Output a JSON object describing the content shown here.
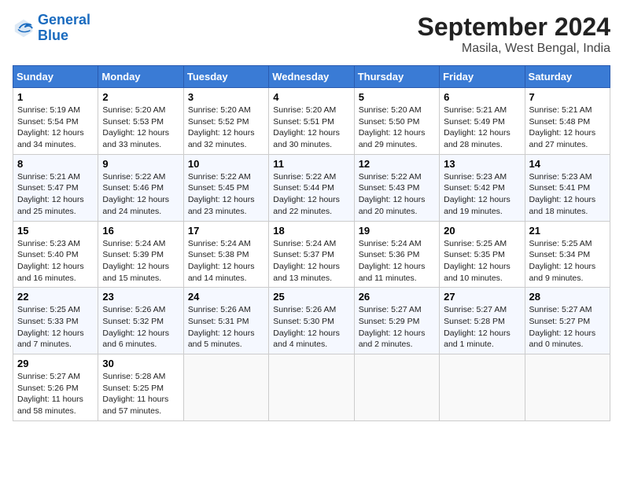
{
  "logo": {
    "line1": "General",
    "line2": "Blue"
  },
  "title": "September 2024",
  "subtitle": "Masila, West Bengal, India",
  "header_days": [
    "Sunday",
    "Monday",
    "Tuesday",
    "Wednesday",
    "Thursday",
    "Friday",
    "Saturday"
  ],
  "weeks": [
    [
      {
        "day": "1",
        "info": "Sunrise: 5:19 AM\nSunset: 5:54 PM\nDaylight: 12 hours\nand 34 minutes."
      },
      {
        "day": "2",
        "info": "Sunrise: 5:20 AM\nSunset: 5:53 PM\nDaylight: 12 hours\nand 33 minutes."
      },
      {
        "day": "3",
        "info": "Sunrise: 5:20 AM\nSunset: 5:52 PM\nDaylight: 12 hours\nand 32 minutes."
      },
      {
        "day": "4",
        "info": "Sunrise: 5:20 AM\nSunset: 5:51 PM\nDaylight: 12 hours\nand 30 minutes."
      },
      {
        "day": "5",
        "info": "Sunrise: 5:20 AM\nSunset: 5:50 PM\nDaylight: 12 hours\nand 29 minutes."
      },
      {
        "day": "6",
        "info": "Sunrise: 5:21 AM\nSunset: 5:49 PM\nDaylight: 12 hours\nand 28 minutes."
      },
      {
        "day": "7",
        "info": "Sunrise: 5:21 AM\nSunset: 5:48 PM\nDaylight: 12 hours\nand 27 minutes."
      }
    ],
    [
      {
        "day": "8",
        "info": "Sunrise: 5:21 AM\nSunset: 5:47 PM\nDaylight: 12 hours\nand 25 minutes."
      },
      {
        "day": "9",
        "info": "Sunrise: 5:22 AM\nSunset: 5:46 PM\nDaylight: 12 hours\nand 24 minutes."
      },
      {
        "day": "10",
        "info": "Sunrise: 5:22 AM\nSunset: 5:45 PM\nDaylight: 12 hours\nand 23 minutes."
      },
      {
        "day": "11",
        "info": "Sunrise: 5:22 AM\nSunset: 5:44 PM\nDaylight: 12 hours\nand 22 minutes."
      },
      {
        "day": "12",
        "info": "Sunrise: 5:22 AM\nSunset: 5:43 PM\nDaylight: 12 hours\nand 20 minutes."
      },
      {
        "day": "13",
        "info": "Sunrise: 5:23 AM\nSunset: 5:42 PM\nDaylight: 12 hours\nand 19 minutes."
      },
      {
        "day": "14",
        "info": "Sunrise: 5:23 AM\nSunset: 5:41 PM\nDaylight: 12 hours\nand 18 minutes."
      }
    ],
    [
      {
        "day": "15",
        "info": "Sunrise: 5:23 AM\nSunset: 5:40 PM\nDaylight: 12 hours\nand 16 minutes."
      },
      {
        "day": "16",
        "info": "Sunrise: 5:24 AM\nSunset: 5:39 PM\nDaylight: 12 hours\nand 15 minutes."
      },
      {
        "day": "17",
        "info": "Sunrise: 5:24 AM\nSunset: 5:38 PM\nDaylight: 12 hours\nand 14 minutes."
      },
      {
        "day": "18",
        "info": "Sunrise: 5:24 AM\nSunset: 5:37 PM\nDaylight: 12 hours\nand 13 minutes."
      },
      {
        "day": "19",
        "info": "Sunrise: 5:24 AM\nSunset: 5:36 PM\nDaylight: 12 hours\nand 11 minutes."
      },
      {
        "day": "20",
        "info": "Sunrise: 5:25 AM\nSunset: 5:35 PM\nDaylight: 12 hours\nand 10 minutes."
      },
      {
        "day": "21",
        "info": "Sunrise: 5:25 AM\nSunset: 5:34 PM\nDaylight: 12 hours\nand 9 minutes."
      }
    ],
    [
      {
        "day": "22",
        "info": "Sunrise: 5:25 AM\nSunset: 5:33 PM\nDaylight: 12 hours\nand 7 minutes."
      },
      {
        "day": "23",
        "info": "Sunrise: 5:26 AM\nSunset: 5:32 PM\nDaylight: 12 hours\nand 6 minutes."
      },
      {
        "day": "24",
        "info": "Sunrise: 5:26 AM\nSunset: 5:31 PM\nDaylight: 12 hours\nand 5 minutes."
      },
      {
        "day": "25",
        "info": "Sunrise: 5:26 AM\nSunset: 5:30 PM\nDaylight: 12 hours\nand 4 minutes."
      },
      {
        "day": "26",
        "info": "Sunrise: 5:27 AM\nSunset: 5:29 PM\nDaylight: 12 hours\nand 2 minutes."
      },
      {
        "day": "27",
        "info": "Sunrise: 5:27 AM\nSunset: 5:28 PM\nDaylight: 12 hours\nand 1 minute."
      },
      {
        "day": "28",
        "info": "Sunrise: 5:27 AM\nSunset: 5:27 PM\nDaylight: 12 hours\nand 0 minutes."
      }
    ],
    [
      {
        "day": "29",
        "info": "Sunrise: 5:27 AM\nSunset: 5:26 PM\nDaylight: 11 hours\nand 58 minutes."
      },
      {
        "day": "30",
        "info": "Sunrise: 5:28 AM\nSunset: 5:25 PM\nDaylight: 11 hours\nand 57 minutes."
      },
      null,
      null,
      null,
      null,
      null
    ]
  ]
}
